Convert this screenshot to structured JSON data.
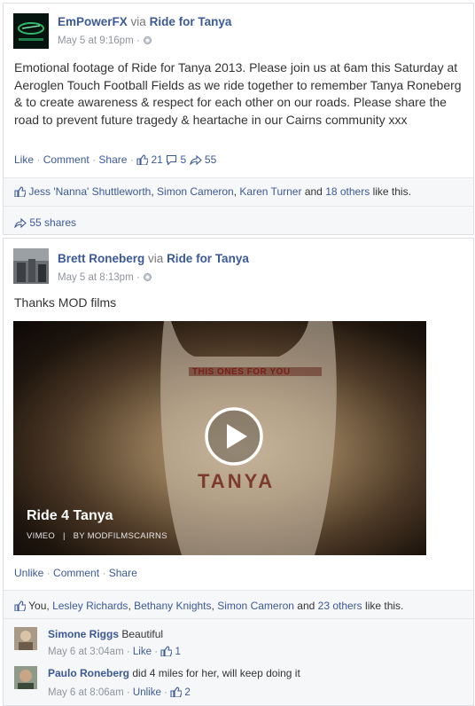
{
  "post1": {
    "author": "EmPowerFX",
    "via": "via",
    "page": "Ride for Tanya",
    "time": "May 5 at 9:16pm",
    "dot": "·",
    "body": "Emotional footage of Ride for Tanya 2013. Please join us at 6am this Saturday at Aeroglen Touch Football Fields as we ride together to remember Tanya Roneberg & to create awareness & respect for each other on our roads. Please share the road to prevent future tragedy & heartache in our Cairns community xxx",
    "actions": {
      "like": "Like",
      "comment": "Comment",
      "share": "Share",
      "dot": "·",
      "like_count": "21",
      "comment_count": "5",
      "share_count": "55"
    },
    "likes": {
      "names": [
        "Jess 'Nanna' Shuttleworth",
        "Simon Cameron",
        "Karen Turner"
      ],
      "comma": ",",
      "and": "and",
      "others": "18 others",
      "suffix": "like this."
    },
    "shares": "55 shares"
  },
  "post2": {
    "author": "Brett Roneberg",
    "via": "via",
    "page": "Ride for Tanya",
    "time": "May 5 at 8:13pm",
    "dot": "·",
    "body": "Thanks MOD films",
    "video": {
      "shirt_top": "THIS ONES FOR YOU",
      "shirt_name": "TANYA",
      "title": "Ride 4 Tanya",
      "source": "VIMEO",
      "divider": "|",
      "byline": "BY MODFILMSCAIRNS"
    },
    "actions": {
      "unlike": "Unlike",
      "comment": "Comment",
      "share": "Share",
      "dot": "·"
    },
    "likes": {
      "you": "You,",
      "names": [
        "Lesley Richards",
        "Bethany Knights",
        "Simon Cameron"
      ],
      "comma": ",",
      "and": "and",
      "others": "23 others",
      "suffix": "like this."
    },
    "comments": [
      {
        "name": "Simone Riggs",
        "text": "Beautiful",
        "time": "May 6 at 3:04am",
        "action": "Like",
        "likes": "1"
      },
      {
        "name": "Paulo Roneberg",
        "text": "did 4 miles for her, will keep doing it",
        "time": "May 6 at 8:06am",
        "action": "Unlike",
        "likes": "2"
      }
    ]
  },
  "colors": {
    "link": "#3b5998",
    "meta": "#90949c",
    "likebar": "#f6f7f9"
  }
}
